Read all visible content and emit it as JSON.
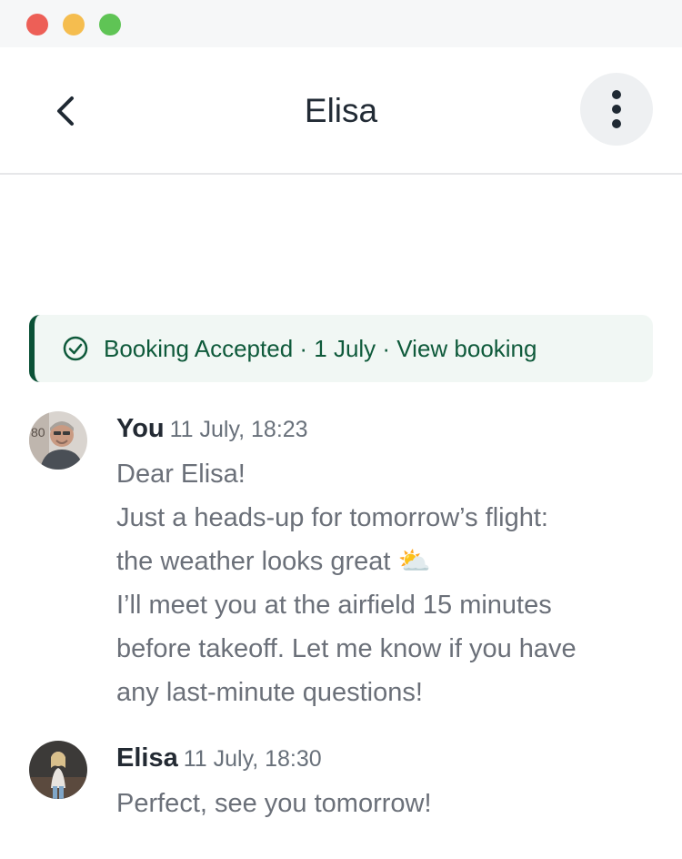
{
  "header": {
    "title": "Elisa"
  },
  "booking_banner": {
    "status": "Booking Accepted",
    "separator": " · ",
    "date": "1 July",
    "link_label": "View booking",
    "accent_color": "#0b5136"
  },
  "messages": [
    {
      "sender": "You",
      "timestamp": "11 July, 18:23",
      "lines": [
        "Dear Elisa!",
        "Just a heads-up for tomorrow’s flight:",
        "the weather looks great ⛅",
        "I’ll meet you at the airfield 15 minutes",
        "before takeoff. Let me know if you have",
        "any last-minute questions!"
      ]
    },
    {
      "sender": "Elisa",
      "timestamp": "11 July, 18:30",
      "lines": [
        "Perfect, see you tomorrow!"
      ]
    }
  ],
  "icons": {
    "back": "chevron-left-icon",
    "menu": "more-vertical-icon",
    "booking_status": "check-circle-icon"
  }
}
